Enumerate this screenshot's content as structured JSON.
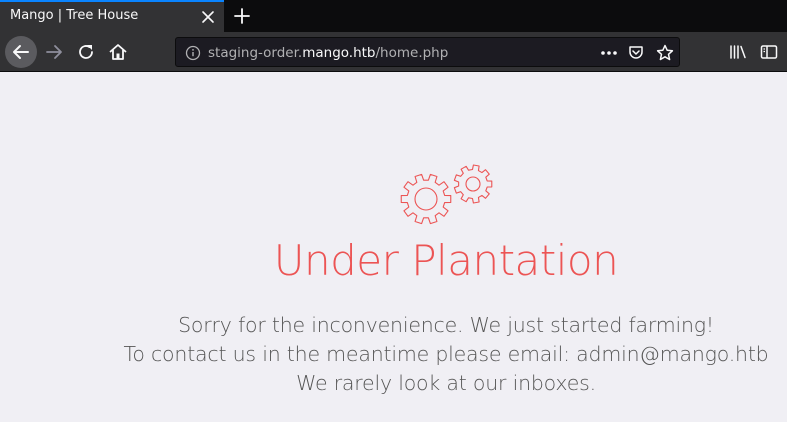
{
  "browser": {
    "tab": {
      "title": "Mango | Tree House"
    },
    "url": {
      "prefix": "staging-order.",
      "host": "mango.htb",
      "path": "/home.php"
    }
  },
  "page": {
    "headline": "Under Plantation",
    "lines": [
      "Sorry for the inconvenience. We just started farming!",
      "To contact us in the meantime please email: admin@mango.htb",
      "We rarely look at our inboxes."
    ],
    "accent_color": "#ec5454",
    "icon": "gears-icon"
  }
}
